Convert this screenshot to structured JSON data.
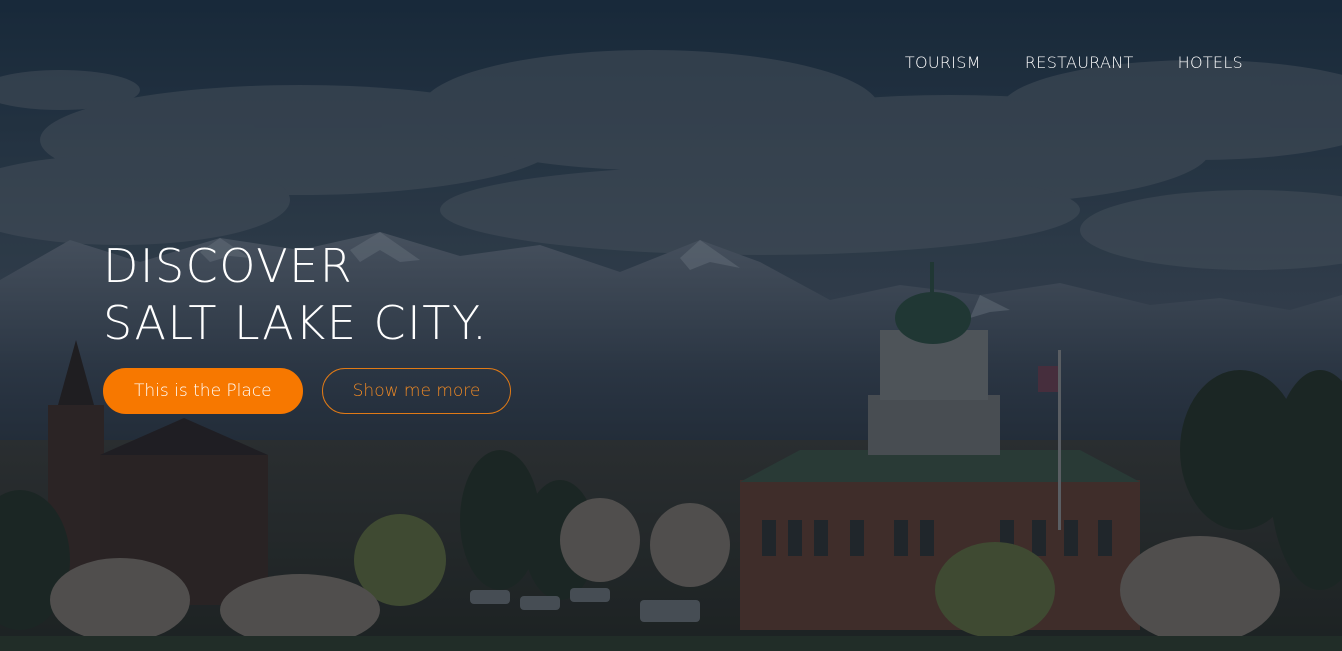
{
  "nav": {
    "items": [
      {
        "label": "TOURISM"
      },
      {
        "label": "RESTAURANT"
      },
      {
        "label": "HOTELS"
      }
    ]
  },
  "hero": {
    "headline_line1": "DISCOVER",
    "headline_line2": "SALT LAKE CITY.",
    "primary_button": "This is the Place",
    "secondary_button": "Show me more"
  },
  "colors": {
    "accent": "#f77800",
    "text": "#ffffff"
  }
}
